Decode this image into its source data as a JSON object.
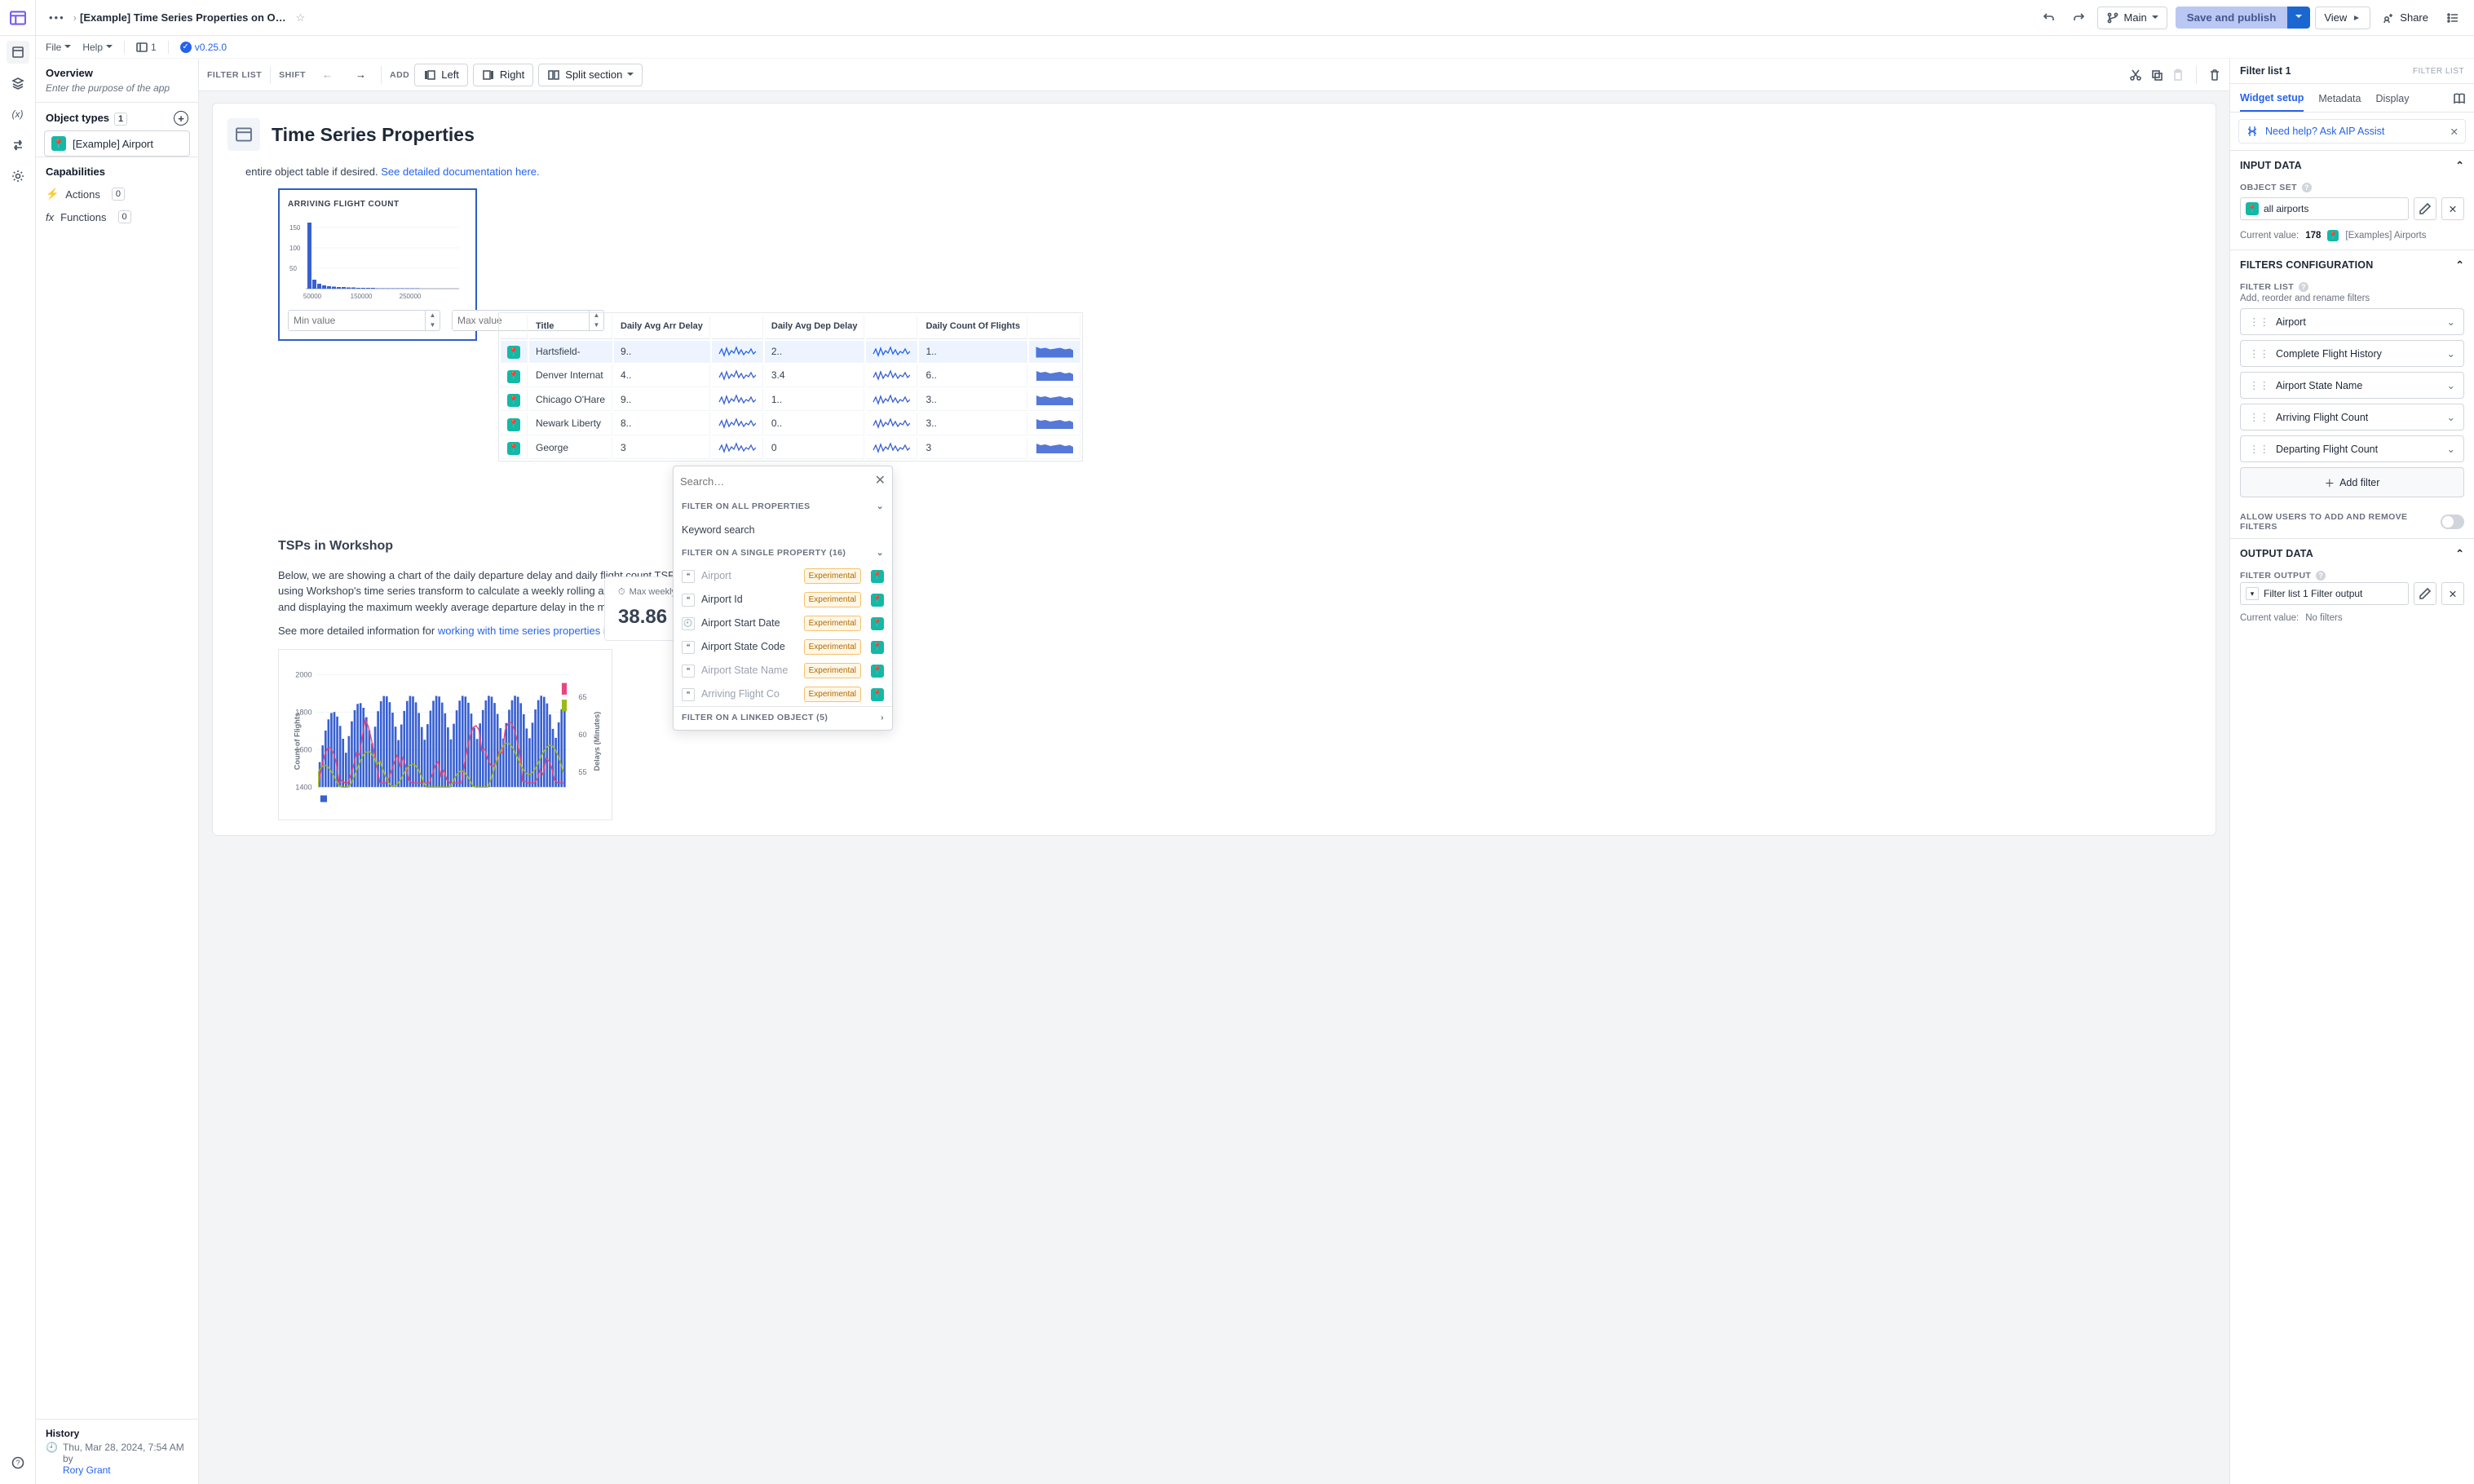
{
  "topbar": {
    "breadcrumb_title": "[Example] Time Series Properties on O…",
    "file_menu": "File",
    "help_menu": "Help",
    "branch_icon_count": "1",
    "version": "v0.25.0",
    "branch_name": "Main",
    "save_publish": "Save and publish",
    "view": "View",
    "share": "Share"
  },
  "sidebar": {
    "overview": "Overview",
    "purpose_hint": "Enter the purpose of the app",
    "object_types": "Object types",
    "object_types_count": "1",
    "chip_label": "[Example] Airport",
    "capabilities": "Capabilities",
    "actions": "Actions",
    "actions_count": "0",
    "functions": "Functions",
    "functions_count": "0",
    "history": "History",
    "history_ts": "Thu, Mar 28, 2024, 7:54 AM by",
    "history_user": "Rory Grant"
  },
  "canvas_toolbar": {
    "filter_list": "FILTER LIST",
    "shift": "SHIFT",
    "add": "ADD",
    "left": "Left",
    "right": "Right",
    "split": "Split section"
  },
  "page": {
    "title": "Time Series Properties",
    "intro_tail": "entire object table if desired. ",
    "intro_link": "See detailed documentation here.",
    "fw_title": "ARRIVING FLIGHT COUNT",
    "min_ph": "Min value",
    "max_ph": "Max value",
    "section2_title": "TSPs in Workshop",
    "p2a": "Below, we are showing a chart of the daily departure delay and daily flight count TSPs on the ",
    "p2b": "using Workshop's time series transform to calculate a weekly rolling average departure delay, ",
    "p2c": "and displaying the maximum weekly average departure delay in the metric card on the right.",
    "p3a": "See more detailed information for ",
    "p3link": "working with time series properties in Workshop here",
    "metric_label": "Max weekly a…",
    "metric_value": "38.86"
  },
  "table": {
    "cols": [
      "Title",
      "Daily Avg Arr Delay",
      "Daily Avg Dep Delay",
      "Daily Count Of Flights"
    ],
    "rows": [
      {
        "t": "Hartsfield-",
        "a": "9..",
        "d": "2..",
        "c": "1.."
      },
      {
        "t": "Denver Internat",
        "a": "4..",
        "d": "3.4",
        "c": "6.."
      },
      {
        "t": "Chicago O'Hare",
        "a": "9..",
        "d": "1..",
        "c": "3.."
      },
      {
        "t": "Newark Liberty",
        "a": "8..",
        "d": "0..",
        "c": "3.."
      },
      {
        "t": "George",
        "a": "3",
        "d": "0",
        "c": "3"
      }
    ]
  },
  "chart_data": {
    "type": "bar",
    "title": "ARRIVING FLIGHT COUNT",
    "x_ticks": [
      "50000",
      "150000",
      "250000"
    ],
    "y_ticks": [
      "50",
      "100",
      "150"
    ],
    "ylim": [
      0,
      160
    ],
    "xlim": [
      0,
      300000
    ],
    "values_by_bin": [
      162,
      22,
      12,
      8,
      6,
      5,
      4,
      4,
      3,
      3,
      2,
      2,
      2,
      2,
      1,
      1,
      1,
      1,
      1,
      1,
      1,
      1,
      1,
      0,
      0,
      0,
      0,
      0,
      0,
      0
    ]
  },
  "dropdown": {
    "search_ph": "Search…",
    "all_props": "FILTER ON ALL PROPERTIES",
    "keyword": "Keyword search",
    "single_props": "FILTER ON A SINGLE PROPERTY (16)",
    "linked": "FILTER ON A LINKED OBJECT (5)",
    "opts": [
      {
        "t": "Airport",
        "muted": true
      },
      {
        "t": "Airport Id",
        "muted": false
      },
      {
        "t": "Airport Start Date",
        "muted": false,
        "clock": true
      },
      {
        "t": "Airport State Code",
        "muted": false
      },
      {
        "t": "Airport State Name",
        "muted": true
      },
      {
        "t": "Arriving Flight Co",
        "muted": true
      }
    ],
    "tag": "Experimental"
  },
  "rpanel": {
    "title": "Filter list 1",
    "crumb": "FILTER LIST",
    "tabs": {
      "setup": "Widget setup",
      "meta": "Metadata",
      "disp": "Display"
    },
    "aip_text": "Need help? Ask AIP Assist",
    "input_data": "INPUT DATA",
    "object_set": "OBJECT SET",
    "obj_pill": "all airports",
    "cv_label": "Current value:",
    "cv_count": "178",
    "cv_txt": "[Examples] Airports",
    "filters_config": "FILTERS CONFIGURATION",
    "filter_list_lab": "FILTER LIST",
    "filter_list_hint": "Add, reorder and rename filters",
    "items": [
      "Airport",
      "Complete Flight History",
      "Airport State Name",
      "Arriving Flight Count",
      "Departing Flight Count"
    ],
    "add_filter": "Add filter",
    "allow_toggle": "ALLOW USERS TO ADD AND REMOVE FILTERS",
    "output_data": "OUTPUT DATA",
    "filter_output_lab": "FILTER OUTPUT",
    "outchip": "Filter list 1 Filter output",
    "out_cv_label": "Current value:",
    "out_cv_val": "No filters"
  }
}
